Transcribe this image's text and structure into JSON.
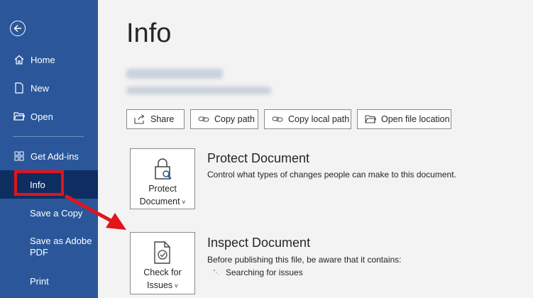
{
  "sidebar": {
    "items": [
      {
        "label": "Home"
      },
      {
        "label": "New"
      },
      {
        "label": "Open"
      },
      {
        "label": "Get Add-ins"
      },
      {
        "label": "Info"
      },
      {
        "label": "Save a Copy"
      },
      {
        "label": "Save as Adobe PDF"
      },
      {
        "label": "Print"
      }
    ]
  },
  "main": {
    "title": "Info",
    "actions": [
      {
        "label": "Share",
        "icon": "share-icon"
      },
      {
        "label": "Copy path",
        "icon": "link-icon"
      },
      {
        "label": "Copy local path",
        "icon": "link-icon"
      },
      {
        "label": "Open file location",
        "icon": "folder-icon"
      }
    ],
    "protect": {
      "button_line1": "Protect",
      "button_line2": "Document",
      "title": "Protect Document",
      "description": "Control what types of changes people can make to this document."
    },
    "inspect": {
      "button_line1": "Check for",
      "button_line2": "Issues",
      "title": "Inspect Document",
      "description": "Before publishing this file, be aware that it contains:",
      "status": "Searching for issues"
    }
  },
  "colors": {
    "sidebar": "#2b579a",
    "sidebar_active": "#0e2e62",
    "highlight": "#e3141b"
  }
}
